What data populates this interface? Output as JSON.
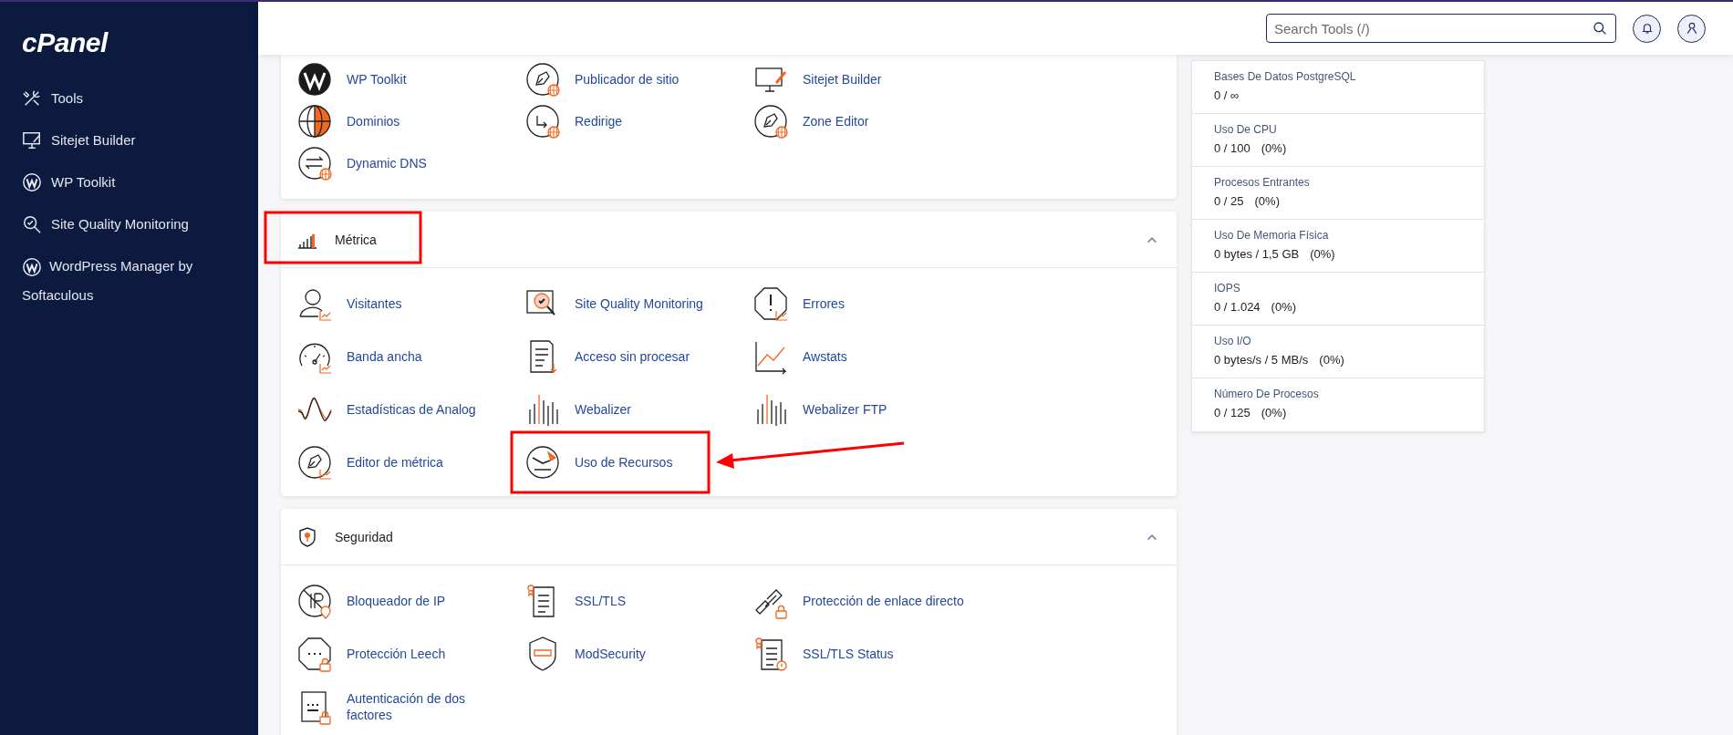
{
  "logo": "cPanel",
  "sidebar": {
    "items": [
      {
        "label": "Tools"
      },
      {
        "label": "Sitejet Builder"
      },
      {
        "label": "WP Toolkit"
      },
      {
        "label": "Site Quality Monitoring"
      },
      {
        "label": "WordPress Manager by Softaculous"
      }
    ]
  },
  "search": {
    "placeholder": "Search Tools (/)"
  },
  "sections": [
    {
      "tools": [
        {
          "label": "WP Toolkit"
        },
        {
          "label": "Publicador de sitio"
        },
        {
          "label": "Sitejet Builder"
        },
        {
          "label": "Dominios"
        },
        {
          "label": "Redirige"
        },
        {
          "label": "Zone Editor"
        },
        {
          "label": "Dynamic DNS"
        }
      ]
    },
    {
      "title": "Métrica",
      "expanded": true,
      "tools": [
        {
          "label": "Visitantes"
        },
        {
          "label": "Site Quality Monitoring"
        },
        {
          "label": "Errores"
        },
        {
          "label": "Banda ancha"
        },
        {
          "label": "Acceso sin procesar"
        },
        {
          "label": "Awstats"
        },
        {
          "label": "Estadísticas de Analog"
        },
        {
          "label": "Webalizer"
        },
        {
          "label": "Webalizer FTP"
        },
        {
          "label": "Editor de métrica"
        },
        {
          "label": "Uso de Recursos"
        }
      ]
    },
    {
      "title": "Seguridad",
      "expanded": true,
      "tools": [
        {
          "label": "Bloqueador de IP"
        },
        {
          "label": "SSL/TLS"
        },
        {
          "label": "Protección de enlace directo"
        },
        {
          "label": "Protección Leech"
        },
        {
          "label": "ModSecurity"
        },
        {
          "label": "SSL/TLS Status"
        },
        {
          "label": "Autenticación de dos factores"
        }
      ]
    }
  ],
  "stats": [
    {
      "label": "Bases De Datos PostgreSQL",
      "value": "0 / ∞"
    },
    {
      "label": "Uso De CPU",
      "value": "0 / 100",
      "percent": "(0%)"
    },
    {
      "label": "Procesos Entrantes",
      "value": "0 / 25",
      "percent": "(0%)"
    },
    {
      "label": "Uso De Memoria Física",
      "value": "0 bytes / 1,5 GB",
      "percent": "(0%)"
    },
    {
      "label": "IOPS",
      "value": "0 / 1.024",
      "percent": "(0%)"
    },
    {
      "label": "Uso I/O",
      "value": "0 bytes/s / 5 MB/s",
      "percent": "(0%)"
    },
    {
      "label": "Número De Procesos",
      "value": "0 / 125",
      "percent": "(0%)"
    }
  ]
}
